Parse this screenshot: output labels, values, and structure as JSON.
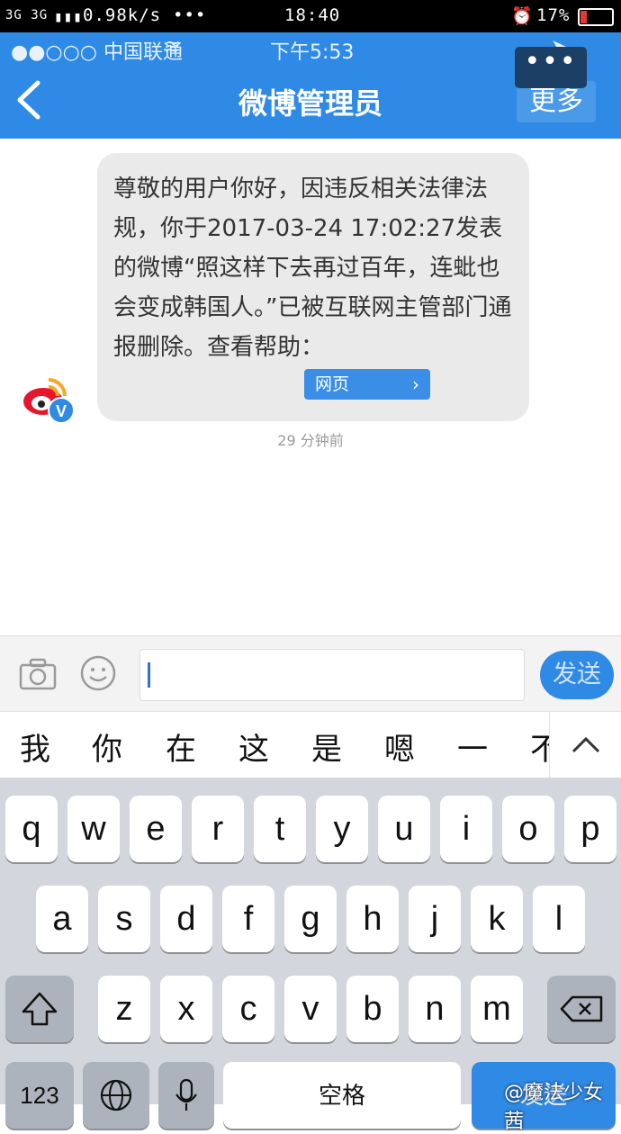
{
  "android_status": {
    "network": "3G 3G",
    "speed": "0.98k/s",
    "dots": "•••",
    "time": "18:40",
    "battery": "17%"
  },
  "ios_status": {
    "carrier": "●●○○○ 中国联通",
    "time": "下午5:53"
  },
  "nav": {
    "title": "微博管理员",
    "more_label": "更多",
    "overflow_label": "•••"
  },
  "message": {
    "text": "尊敬的用户你好，因违反相关法律法规，你于2017-03-24 17:02:27发表的微博“照这样下去再过百年，连蚍也会变成韩国人。”已被互联网主管部门通报删除。查看帮助：",
    "link_label": "网页",
    "link_arrow": "›",
    "time": "29 分钟前"
  },
  "input": {
    "send_label": "发送"
  },
  "candidates": [
    "我",
    "你",
    "在",
    "这",
    "是",
    "嗯",
    "一",
    "不"
  ],
  "keyboard": {
    "row1": [
      "q",
      "w",
      "e",
      "r",
      "t",
      "y",
      "u",
      "i",
      "o",
      "p"
    ],
    "row2": [
      "a",
      "s",
      "d",
      "f",
      "g",
      "h",
      "j",
      "k",
      "l"
    ],
    "row3": [
      "z",
      "x",
      "c",
      "v",
      "b",
      "n",
      "m"
    ],
    "num_label": "123",
    "space_label": "空格",
    "done_label": "发送"
  },
  "watermark": "@魔法少女茜",
  "colors": {
    "accent": "#2f8ae5",
    "bubble": "#eaeaea",
    "keyboard": "#d3d6dc"
  }
}
